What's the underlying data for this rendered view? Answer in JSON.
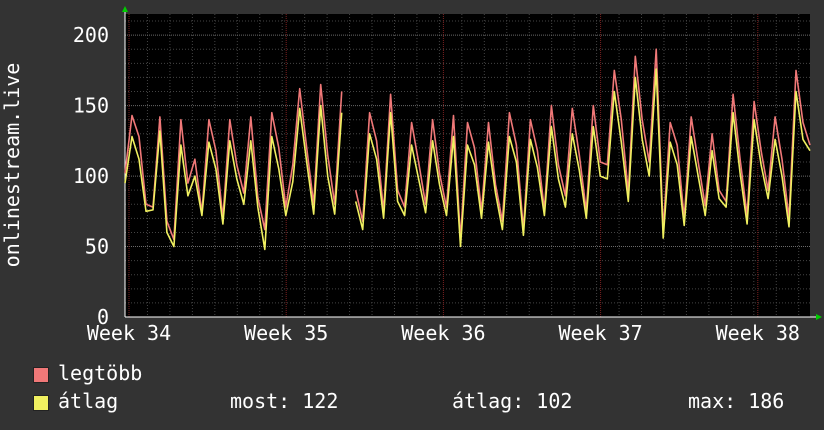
{
  "chart_data": {
    "type": "line",
    "ylabel": "onlinestream.live",
    "ylim": [
      0,
      215
    ],
    "yticks": [
      0,
      50,
      100,
      150,
      200
    ],
    "xticks": [
      "Week 34",
      "Week 35",
      "Week 36",
      "Week 37",
      "Week 38"
    ],
    "grid": true,
    "legend_position": "bottom-left",
    "colors": {
      "background": "#333333",
      "plot": "#000000",
      "grid": "#444444",
      "week_line": "#7a2020",
      "legegyebb_line": "#f07878",
      "atlag_line": "#f0f060",
      "arrow": "#00cc00"
    },
    "series": [
      {
        "name": "legtöbb",
        "color": "#f07878",
        "values": [
          102,
          143,
          128,
          80,
          78,
          142,
          68,
          55,
          140,
          95,
          112,
          74,
          140,
          118,
          70,
          140,
          108,
          88,
          142,
          85,
          62,
          145,
          120,
          78,
          108,
          162,
          120,
          80,
          165,
          115,
          80,
          160,
          null,
          90,
          68,
          145,
          125,
          75,
          158,
          90,
          78,
          138,
          110,
          80,
          140,
          102,
          78,
          143,
          55,
          138,
          120,
          75,
          138,
          94,
          68,
          145,
          122,
          62,
          140,
          118,
          76,
          150,
          108,
          86,
          148,
          115,
          75,
          150,
          110,
          108,
          175,
          140,
          88,
          185,
          140,
          110,
          190,
          62,
          138,
          122,
          70,
          142,
          110,
          79,
          130,
          90,
          82,
          158,
          112,
          72,
          153,
          118,
          90,
          142,
          112,
          70,
          175,
          138,
          122
        ]
      },
      {
        "name": "átlag",
        "color": "#f0f060",
        "values": [
          95,
          128,
          112,
          75,
          76,
          132,
          60,
          50,
          122,
          86,
          100,
          72,
          124,
          105,
          66,
          125,
          98,
          80,
          125,
          78,
          48,
          128,
          105,
          72,
          96,
          148,
          110,
          73,
          150,
          100,
          73,
          145,
          null,
          82,
          62,
          130,
          112,
          70,
          145,
          82,
          72,
          122,
          98,
          74,
          125,
          94,
          72,
          128,
          50,
          122,
          108,
          70,
          124,
          88,
          62,
          128,
          110,
          58,
          126,
          106,
          72,
          135,
          98,
          78,
          130,
          104,
          70,
          135,
          100,
          98,
          160,
          124,
          82,
          170,
          126,
          100,
          176,
          56,
          124,
          108,
          65,
          128,
          100,
          72,
          118,
          84,
          78,
          145,
          102,
          66,
          140,
          108,
          84,
          126,
          100,
          64,
          160,
          126,
          118
        ]
      }
    ]
  },
  "legend": {
    "items": [
      {
        "label": "legtöbb",
        "color": "#f07878"
      },
      {
        "label": "átlag",
        "color": "#f0f060"
      }
    ],
    "stats": {
      "most": "most: 122",
      "atlag": "átlag: 102",
      "max": "max: 186"
    }
  }
}
